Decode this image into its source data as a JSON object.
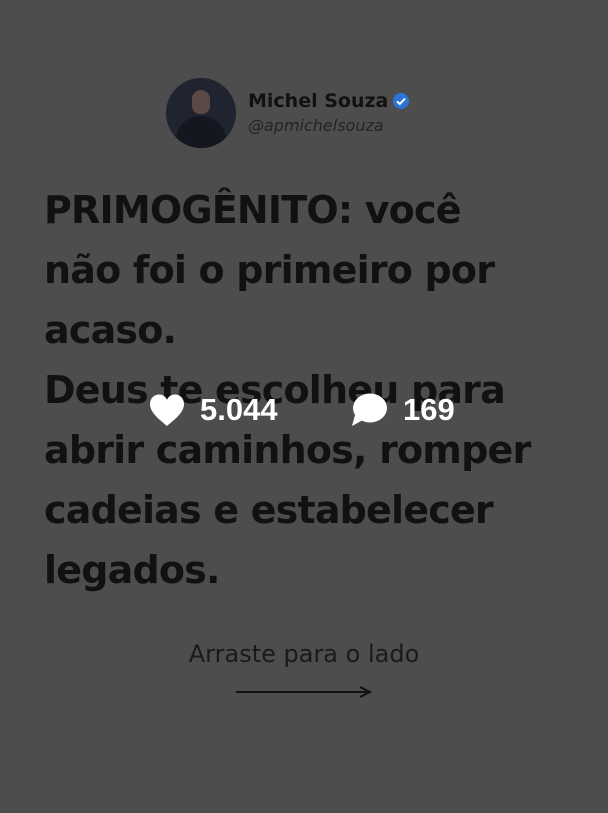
{
  "author": {
    "name": "Michel Souza",
    "handle": "@apmichelsouza",
    "verified": true
  },
  "post": {
    "lines": [
      "PRIMOGÊNITO: você",
      "não foi o primeiro por",
      "acaso.",
      "Deus te escolheu para",
      "abrir caminhos, romper",
      "cadeias e estabelecer",
      "legados."
    ]
  },
  "stats": {
    "likes": "5.044",
    "comments": "169"
  },
  "swipe": {
    "label": "Arraste para o lado"
  },
  "icons": {
    "verified": "verified-badge-icon",
    "likes": "heart-icon",
    "comments": "speech-bubble-icon",
    "swipe": "arrow-right-icon"
  },
  "colors": {
    "background": "#4d4d4d",
    "text": "#111111",
    "verified": "#2d74d6",
    "overlay_text": "#ffffff"
  }
}
